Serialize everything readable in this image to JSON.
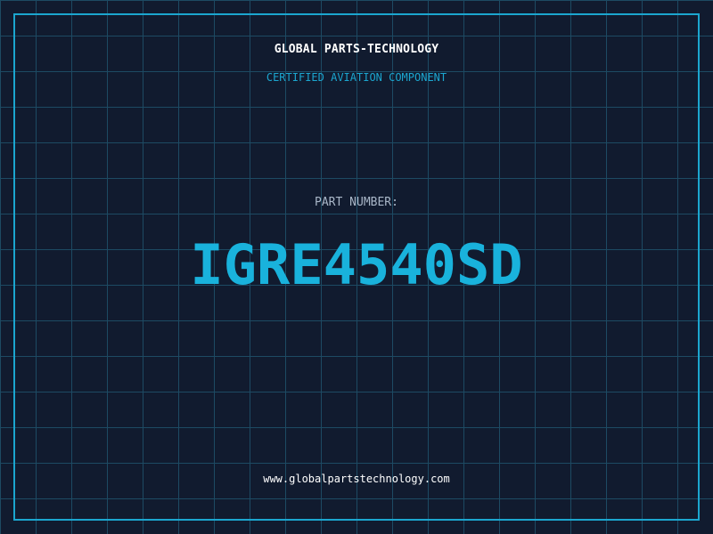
{
  "header": {
    "company": "GLOBAL PARTS-TECHNOLOGY",
    "subtitle": "CERTIFIED AVIATION COMPONENT"
  },
  "part": {
    "label": "PART NUMBER:",
    "number": "IGRE4540SD"
  },
  "footer": {
    "website": "www.globalpartstechnology.com"
  },
  "colors": {
    "background": "#111b2f",
    "grid": "#1d4a63",
    "accent": "#1ba6cf",
    "part_number": "#19b2dc"
  }
}
